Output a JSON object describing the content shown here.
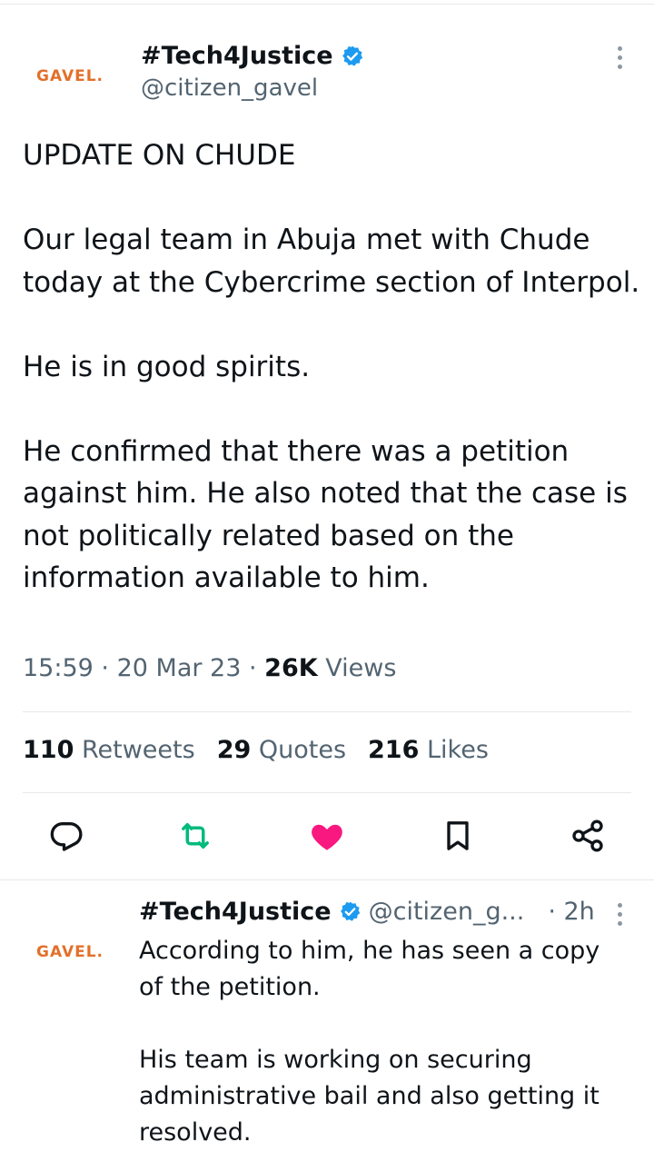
{
  "tweet": {
    "avatar_logo": "GAVEL.",
    "author_name": "#Tech4Justice",
    "author_handle": "@citizen_gavel",
    "text": "UPDATE ON CHUDE\n\nOur legal team in Abuja met with Chude today at the Cybercrime section of Interpol.\n\nHe is in good spirits.\n\nHe confirmed that there was a petition against him. He also noted that the case is not politically related based on the information available to him.",
    "time": "15:59",
    "date": "20 Mar 23",
    "views_count": "26K",
    "views_label": "Views",
    "stats": {
      "retweets_count": "110",
      "retweets_label": "Retweets",
      "quotes_count": "29",
      "quotes_label": "Quotes",
      "likes_count": "216",
      "likes_label": "Likes"
    },
    "liked": true,
    "colors": {
      "like": "#f91880",
      "retweet": "#00ba7c",
      "verified": "#1d9bf0",
      "logo": "#e2702a"
    }
  },
  "reply": {
    "avatar_logo": "GAVEL.",
    "author_name": "#Tech4Justice",
    "author_handle": "@citizen_g...",
    "time": "2h",
    "text": "According to him, he has seen a copy of the petition.\n\nHis team is working on securing administrative bail and also getting it resolved."
  },
  "icons": [
    "verified-badge-icon",
    "more-options-icon",
    "reply-icon",
    "retweet-icon",
    "like-icon",
    "bookmark-icon",
    "share-icon"
  ]
}
